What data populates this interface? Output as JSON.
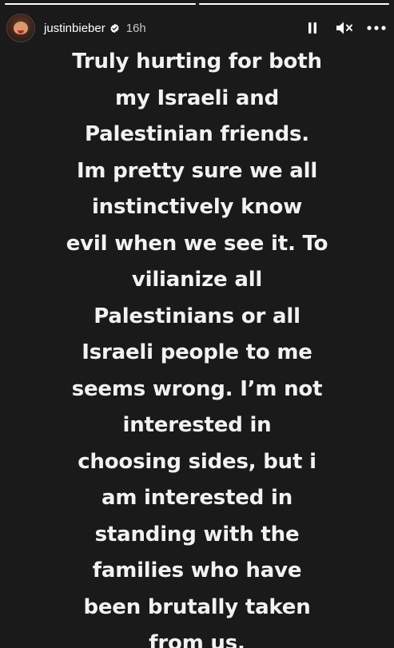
{
  "progress": [
    {
      "fraction": 1.0
    },
    {
      "fraction": 1.0
    }
  ],
  "header": {
    "username": "justinbieber",
    "verified": true,
    "time_ago": "16h",
    "pause_icon": "pause-icon",
    "mute_icon": "mute-icon",
    "more_icon": "more-icon"
  },
  "story": {
    "lines": [
      "Truly hurting for both",
      "my Israeli and",
      "Palestinian friends.",
      "Im pretty sure we all",
      "instinctively know",
      "evil when we see it. To",
      "vilianize all",
      "Palestinians or all",
      "Israeli people to me",
      "seems wrong. I’m not",
      "interested in",
      "choosing sides, but i",
      "am interested in",
      "standing with the",
      "families who have",
      "been brutally taken",
      "from us."
    ]
  },
  "colors": {
    "background": "#1a1a1a",
    "text": "#f2f2f2",
    "verified_badge": "#ffffff"
  }
}
